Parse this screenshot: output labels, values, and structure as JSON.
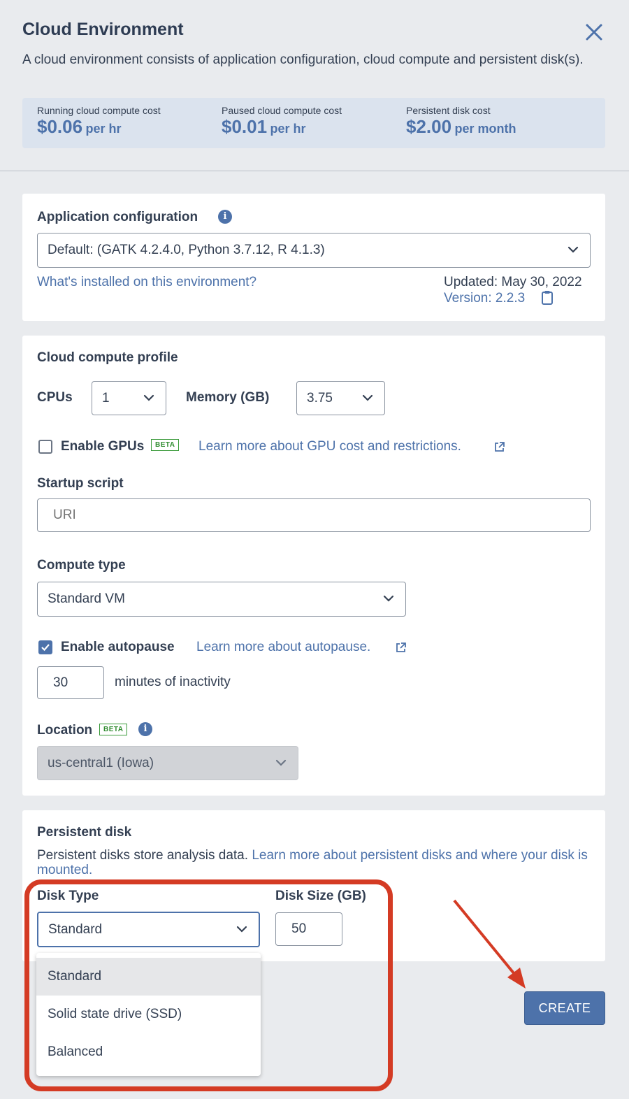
{
  "header": {
    "title": "Cloud Environment",
    "description": "A cloud environment consists of application configuration, cloud compute and persistent disk(s)."
  },
  "costs": [
    {
      "label": "Running cloud compute cost",
      "value": "$0.06",
      "unit": "per hr"
    },
    {
      "label": "Paused cloud compute cost",
      "value": "$0.01",
      "unit": "per hr"
    },
    {
      "label": "Persistent disk cost",
      "value": "$2.00",
      "unit": "per month"
    }
  ],
  "app_config": {
    "heading": "Application configuration",
    "selected": "Default: (GATK 4.2.4.0, Python 3.7.12, R 4.1.3)",
    "installed_link": "What's installed on this environment?",
    "updated": "Updated: May 30, 2022",
    "version": "Version: 2.2.3"
  },
  "compute": {
    "heading": "Cloud compute profile",
    "cpus_label": "CPUs",
    "cpus_value": "1",
    "memory_label": "Memory (GB)",
    "memory_value": "3.75",
    "gpu_label": "Enable GPUs",
    "beta": "BETA",
    "gpu_link": "Learn more about GPU cost and restrictions.",
    "startup_label": "Startup script",
    "startup_placeholder": "URI",
    "compute_type_label": "Compute type",
    "compute_type_value": "Standard VM",
    "autopause_label": "Enable autopause",
    "autopause_link": "Learn more about autopause.",
    "autopause_minutes": "30",
    "autopause_suffix": "minutes of inactivity",
    "location_label": "Location",
    "location_value": "us-central1 (Iowa)"
  },
  "disk": {
    "heading": "Persistent disk",
    "desc_prefix": "Persistent disks store analysis data. ",
    "desc_link": "Learn more about persistent disks and where your disk is mounted.",
    "type_label": "Disk Type",
    "type_value": "Standard",
    "size_label": "Disk Size (GB)",
    "size_value": "50",
    "options": [
      "Standard",
      "Solid state drive (SSD)",
      "Balanced"
    ]
  },
  "actions": {
    "create": "CREATE"
  },
  "colors": {
    "accent": "#4d72aa",
    "annotation": "#d43b24",
    "beta_green": "#2e8b2e"
  }
}
